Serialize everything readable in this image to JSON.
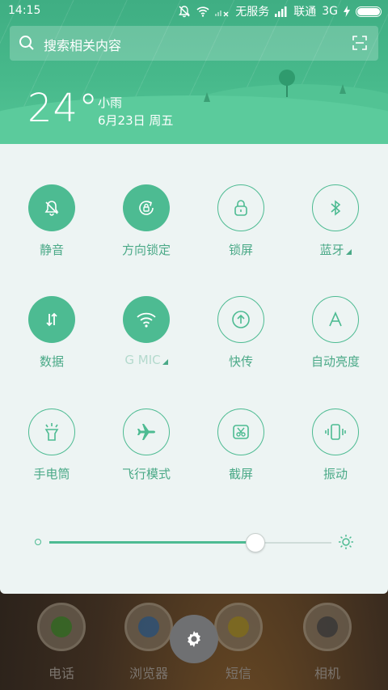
{
  "status_bar": {
    "time": "14:15",
    "no_service": "无服务",
    "carrier": "联通",
    "network": "3G"
  },
  "search": {
    "placeholder": "搜索相关内容"
  },
  "weather": {
    "temperature": "24°",
    "condition": "小雨",
    "date": "6月23日 周五"
  },
  "toggles": [
    {
      "label": "静音",
      "icon": "mute-icon",
      "state": "on"
    },
    {
      "label": "方向锁定",
      "icon": "rotation-lock-icon",
      "state": "on"
    },
    {
      "label": "锁屏",
      "icon": "lock-icon",
      "state": "off"
    },
    {
      "label": "蓝牙",
      "icon": "bluetooth-icon",
      "state": "off",
      "expandable": true
    },
    {
      "label": "数据",
      "icon": "data-icon",
      "state": "on"
    },
    {
      "label": "G   MIC",
      "icon": "wifi-icon",
      "state": "on",
      "expandable": true
    },
    {
      "label": "快传",
      "icon": "transfer-icon",
      "state": "off"
    },
    {
      "label": "自动亮度",
      "icon": "auto-brightness-icon",
      "state": "off"
    },
    {
      "label": "手电筒",
      "icon": "flashlight-icon",
      "state": "off"
    },
    {
      "label": "飞行模式",
      "icon": "airplane-icon",
      "state": "off"
    },
    {
      "label": "截屏",
      "icon": "screenshot-icon",
      "state": "off"
    },
    {
      "label": "振动",
      "icon": "vibrate-icon",
      "state": "off"
    }
  ],
  "brightness": {
    "level": 0.73
  },
  "dock": {
    "apps": [
      {
        "label": "电话",
        "icon": "phone-icon"
      },
      {
        "label": "浏览器",
        "icon": "browser-icon"
      },
      {
        "label": "短信",
        "icon": "messages-icon"
      },
      {
        "label": "相机",
        "icon": "camera-icon"
      }
    ]
  },
  "colors": {
    "accent": "#4dbb92",
    "header": "#47b98b",
    "panel": "#edf4f3"
  }
}
